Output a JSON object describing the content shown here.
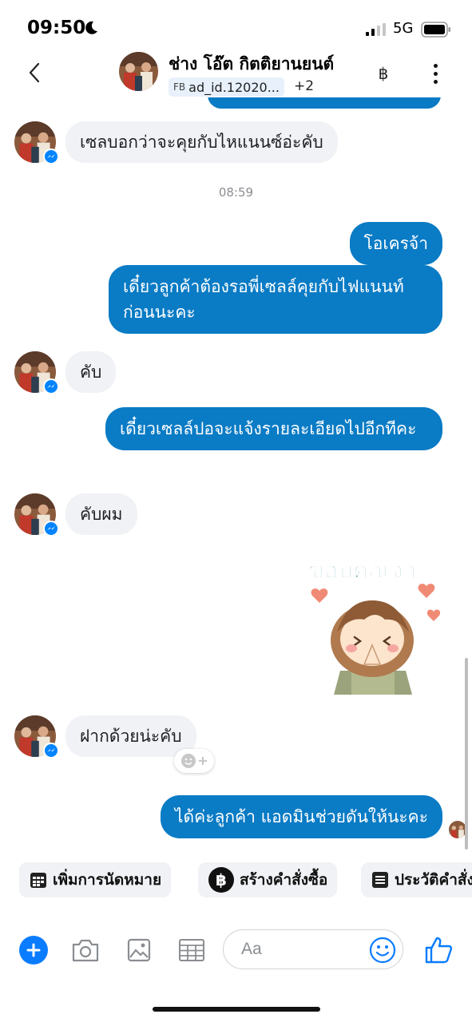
{
  "status_bar": {
    "time": "09:50",
    "network": "5G"
  },
  "header": {
    "contact_name": "ช่าง โอ๊ต กิตติยานยนต์",
    "ad_tag": "FB",
    "ad_id": "ad_id.12020...",
    "extra_labels": "+2",
    "currency_symbol": "฿"
  },
  "messages": [
    {
      "direction": "in",
      "text": "เซลบอกว่าจะคุยกับไหแนนซ์อ่ะคับ"
    },
    {
      "direction": "out",
      "text": "โอเครจ้า"
    },
    {
      "direction": "out",
      "text": "เดี๋ยวลูกค้าต้องรอพี่เซลล์คุยกับไฟแนนท์ก่อนนะคะ"
    },
    {
      "direction": "in",
      "text": "คับ"
    },
    {
      "direction": "out",
      "text": "เดี๋ยวเซลล์ปอจะแจ้งรายละเอียดไปอีกทีคะ"
    },
    {
      "direction": "in",
      "text": "คับผม"
    },
    {
      "direction": "out",
      "sticker_text": "ขอบคุณจ้า"
    },
    {
      "direction": "in",
      "text": "ฝากด้วยน่ะคับ"
    },
    {
      "direction": "out",
      "text": "ได้ค่ะลูกค้า แอดมินช่วยดันให้นะคะ"
    }
  ],
  "timestamp": "08:59",
  "quick_actions": [
    {
      "label": "เพิ่มการนัดหมาย",
      "icon": "calendar-icon"
    },
    {
      "label": "สร้างคำสั่งซื้อ",
      "icon": "baht-icon"
    },
    {
      "label": "ประวัติคำสั่งซื้อ",
      "icon": "receipt-icon"
    }
  ],
  "composer": {
    "placeholder": "Aa"
  },
  "colors": {
    "outgoing_bubble": "#0a7bc5",
    "incoming_bubble": "#f0f2f5",
    "accent": "#0a7cff",
    "messenger_badge": "#0084ff"
  }
}
